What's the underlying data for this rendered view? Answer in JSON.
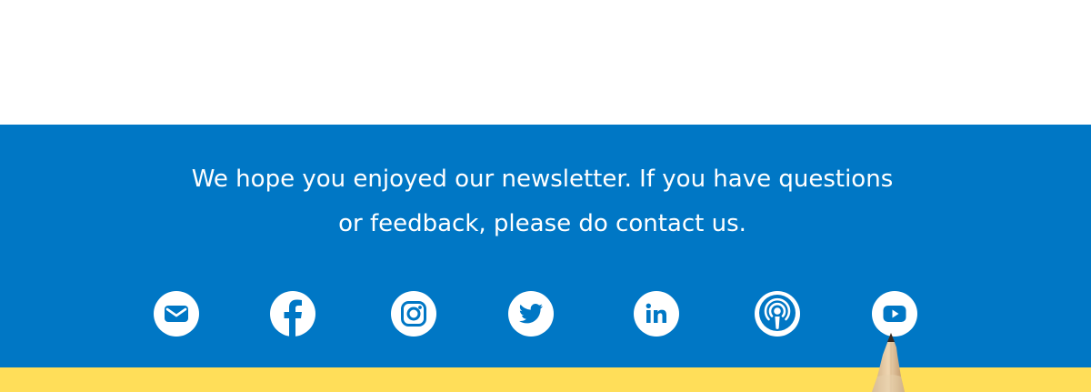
{
  "colors": {
    "footer_blue": "#0077c5",
    "accent_yellow": "#ffde59",
    "icon_white": "#ffffff"
  },
  "footer": {
    "message_line1": "We hope you enjoyed our newsletter. If you have questions",
    "message_line2": "or feedback, please do contact us."
  },
  "social": [
    {
      "icon": "email-icon"
    },
    {
      "icon": "facebook-icon"
    },
    {
      "icon": "instagram-icon"
    },
    {
      "icon": "twitter-icon"
    },
    {
      "icon": "linkedin-icon"
    },
    {
      "icon": "podcast-icon"
    },
    {
      "icon": "youtube-icon"
    }
  ]
}
